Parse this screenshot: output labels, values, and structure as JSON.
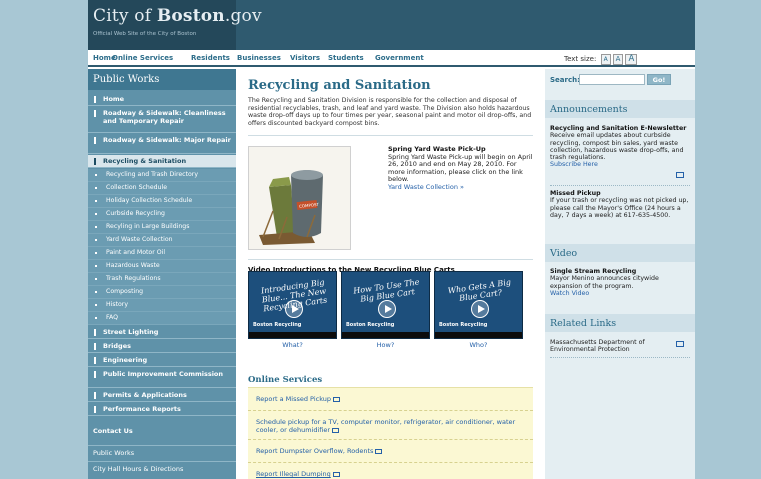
{
  "header": {
    "logo_city": "City of ",
    "logo_boston": "Boston",
    "logo_gov": ".gov",
    "subtitle": "Official Web Site of the City of Boston"
  },
  "topnav": {
    "items": [
      "Home",
      "Online Services",
      "Residents",
      "Businesses",
      "Visitors",
      "Students",
      "Government"
    ],
    "text_size_label": "Text size:",
    "text_size_options": [
      "A",
      "A",
      "A"
    ]
  },
  "leftnav": {
    "heading": "Public Works",
    "items": [
      "Home",
      "Roadway & Sidewalk: Cleanliness and Temporary Repair",
      "Roadway & Sidewalk: Major Repair",
      "Recycling & Sanitation"
    ],
    "subitems": [
      "Recycling and Trash Directory",
      "Collection Schedule",
      "Holiday Collection Schedule",
      "Curbside Recycling",
      "Recyling in Large Buildings",
      "Yard Waste Collection",
      "Paint and Motor Oil",
      "Hazardous Waste",
      "Trash Regulations",
      "Composting",
      "History",
      "FAQ"
    ],
    "items_after": [
      "Street Lighting",
      "Bridges",
      "Engineering",
      "Public Improvement Commission",
      "Permits & Applications",
      "Performance Reports"
    ],
    "contact_heading": "Contact Us",
    "contact_links": [
      "Public Works",
      "City Hall Hours & Directions"
    ]
  },
  "main": {
    "title": "Recycling and Sanitation",
    "intro": "The Recycling and Sanitation Division is responsible for the collection and disposal of residential recyclables, trash, and leaf and yard waste. The Division also holds hazardous waste drop-off days up to four times per year, seasonal paint and motor oil drop-offs, and offers discounted backyard compost bins.",
    "spring_title": "Spring Yard Waste Pick-Up",
    "spring_text": "Spring Yard Waste Pick-up will begin on April 26, 2010 and end on May 28, 2010. For more information, please click on the link below.",
    "spring_link": "Yard Waste Collection »",
    "bin_label": "COMPOST",
    "video_heading": "Video Introductions to the New Recycling Blue Carts",
    "videos": [
      {
        "overlay": "Introducing Big Blue... The New Recycling Carts",
        "caption": "What?"
      },
      {
        "overlay": "How To Use The Big Blue Cart",
        "caption": "How?"
      },
      {
        "overlay": "Who Gets A Big Blue Cart?",
        "caption": "Who?"
      }
    ],
    "video_brand": "Boston Recycling",
    "online_services_heading": "Online Services",
    "online_services": [
      "Report a Missed Pickup",
      "Schedule pickup for a TV, computer monitor, refrigerator, air conditioner, water cooler, or dehumidifier",
      "Report Dumpster Overflow, Rodents",
      "Report Illegal Dumping"
    ]
  },
  "right": {
    "search_label": "Search:",
    "search_value": "",
    "go_label": "Go!",
    "announcements_heading": "Announcements",
    "announce1_title": "Recycling and Sanitation E-Newsletter",
    "announce1_text": "Receive email updates about curbside recycling, compost bin sales, yard waste collection, hazardous waste drop-offs, and trash regulations.",
    "announce1_link": "Subscribe Here",
    "announce2_title": "Missed Pickup",
    "announce2_text": "If your trash or recycling was not picked up, please call the Mayor's Office (24 hours a day, 7 days a week) at 617-635-4500.",
    "video_heading": "Video",
    "video_title": "Single Stream Recycling",
    "video_text": "Mayor Menino announces citywide expansion of the program.",
    "video_link": "Watch Video",
    "related_heading": "Related Links",
    "related_link": "Massachusetts Department of Environmental Protection"
  },
  "colors": {
    "header_bg": "#2f5a6f",
    "nav_bg": "#5f92a9",
    "accent": "#2a6a87",
    "online_box": "#fbf8d3",
    "page_bg": "#a8c7d4"
  }
}
